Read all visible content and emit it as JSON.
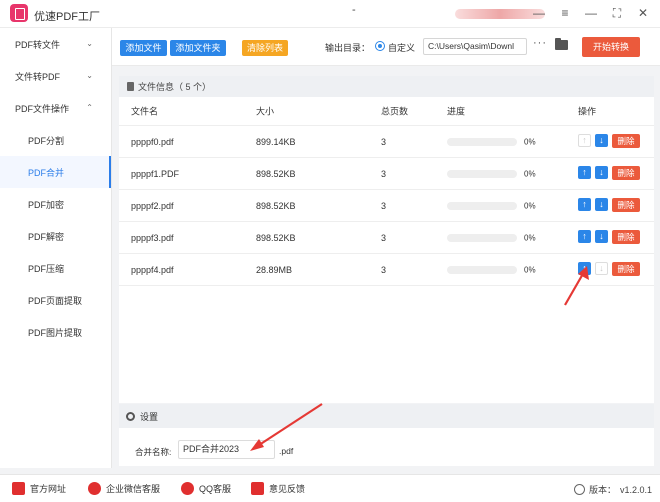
{
  "app": {
    "title": "优速PDF工厂",
    "title_dash": "-"
  },
  "titlebar_icons": [
    "minus-icon",
    "menu-icon",
    "minimize-icon",
    "fullscreen-icon",
    "close-icon"
  ],
  "titlebar_glyphs": {
    "minus": "—",
    "menu": "≡",
    "minimize": "—",
    "fullscreen": "⛶",
    "close": "✕"
  },
  "sidebar": {
    "groups": [
      {
        "label": "PDF转文件",
        "expanded": false
      },
      {
        "label": "文件转PDF",
        "expanded": false
      },
      {
        "label": "PDF文件操作",
        "expanded": true
      }
    ],
    "subitems": [
      "PDF分割",
      "PDF合并",
      "PDF加密",
      "PDF解密",
      "PDF压缩",
      "PDF页面提取",
      "PDF图片提取"
    ],
    "active_subitem": "PDF合并",
    "chevron_collapsed": "⌄",
    "chevron_expanded": "⌃"
  },
  "toolbar": {
    "add_file": "添加文件",
    "add_folder": "添加文件夹",
    "clear_list": "清除列表",
    "output_dir_label": "输出目录：",
    "custom_option": "自定义",
    "output_path": "C:\\Users\\Qasim\\Downl",
    "more": "···",
    "start": "开始转换"
  },
  "file_panel": {
    "title": "文件信息（ 5 个）",
    "columns": [
      "文件名",
      "大小",
      "总页数",
      "进度",
      "操作"
    ],
    "rows": [
      {
        "name": "ppppf0.pdf",
        "size": "899.14KB",
        "pages": "3",
        "progress": "0%",
        "up_enabled": false,
        "down_enabled": true,
        "delete": "删除"
      },
      {
        "name": "ppppf1.PDF",
        "size": "898.52KB",
        "pages": "3",
        "progress": "0%",
        "up_enabled": true,
        "down_enabled": true,
        "delete": "删除"
      },
      {
        "name": "ppppf2.pdf",
        "size": "898.52KB",
        "pages": "3",
        "progress": "0%",
        "up_enabled": true,
        "down_enabled": true,
        "delete": "删除"
      },
      {
        "name": "ppppf3.pdf",
        "size": "898.52KB",
        "pages": "3",
        "progress": "0%",
        "up_enabled": true,
        "down_enabled": true,
        "delete": "删除"
      },
      {
        "name": "ppppf4.pdf",
        "size": "28.89MB",
        "pages": "3",
        "progress": "0%",
        "up_enabled": true,
        "down_enabled": false,
        "delete": "删除"
      }
    ],
    "up_glyph": "↑",
    "down_glyph": "↓"
  },
  "settings": {
    "title": "设置",
    "merge_name_label": "合并名称:",
    "merge_name_value": "PDF合并2023",
    "merge_suffix": ".pdf"
  },
  "footer": {
    "links": [
      "官方网址",
      "企业微信客服",
      "QQ客服",
      "意见反馈"
    ],
    "version_label": "版本：",
    "version": "v1.2.0.1"
  },
  "colors": {
    "accent": "#2b86e8",
    "danger": "#eb5a3c",
    "warning": "#f5a623",
    "brand": "#e8356b"
  }
}
